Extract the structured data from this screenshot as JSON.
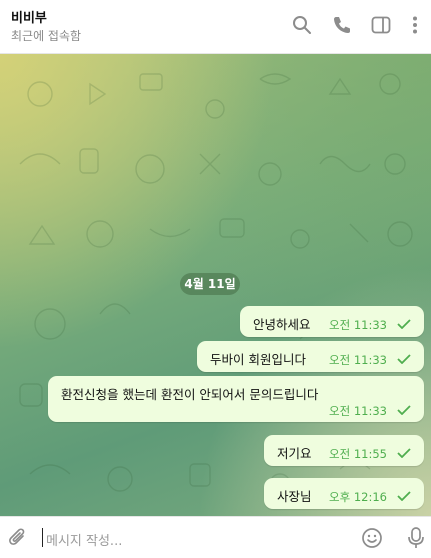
{
  "header": {
    "title": "비비부",
    "status": "최근에 접속함",
    "icons": [
      "search-icon",
      "phone-icon",
      "sidebar-toggle-icon",
      "more-vertical-icon"
    ]
  },
  "chat": {
    "date_label": "4월 11일",
    "messages": [
      {
        "text": "안녕하세요",
        "time": "오전 11:33",
        "status": "read"
      },
      {
        "text": "두바이 회원입니다",
        "time": "오전 11:33",
        "status": "read"
      },
      {
        "text": "환전신청을 했는데 환전이 안되어서 문의드립니다",
        "time": "오전 11:33",
        "status": "read"
      },
      {
        "text": "저기요",
        "time": "오전 11:55",
        "status": "read"
      },
      {
        "text": "사장님",
        "time": "오후 12:16",
        "status": "read"
      }
    ]
  },
  "composer": {
    "placeholder": "메시지 작성...",
    "icons": [
      "attach-icon",
      "emoji-icon",
      "microphone-icon"
    ]
  },
  "colors": {
    "bubble": "#effdde",
    "time_text": "#4fae4e",
    "check": "#4fae4e"
  }
}
